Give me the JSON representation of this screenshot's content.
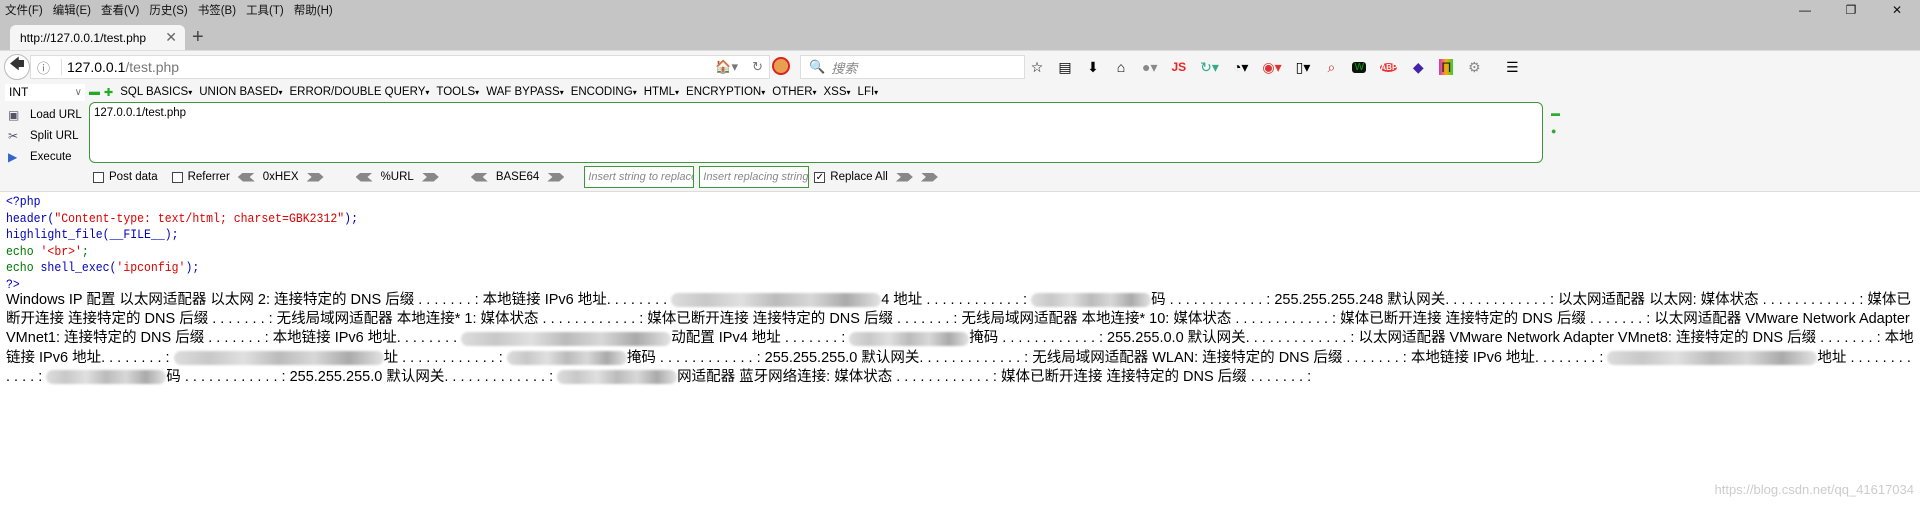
{
  "menubar": {
    "items": [
      "文件(F)",
      "编辑(E)",
      "查看(V)",
      "历史(S)",
      "书签(B)",
      "工具(T)",
      "帮助(H)"
    ]
  },
  "tab": {
    "title": "http://127.0.0.1/test.php"
  },
  "nav": {
    "url_host": "127.0.0.1",
    "url_path": "/test.php",
    "search_placeholder": "搜索"
  },
  "toolbar_icons": [
    "star-icon",
    "reading-list-icon",
    "download-icon",
    "home-icon",
    "globe-icon",
    "js-icon",
    "sync-icon",
    "cookie-icon",
    "hackbar-icon",
    "screenshot-icon",
    "search-highlight-icon",
    "shield-w-icon",
    "adblock-icon",
    "cube-icon",
    "rainbow-icon",
    "gear-icon",
    "hamburger-menu-icon"
  ],
  "hackbar": {
    "select_value": "INT",
    "menus": [
      "SQL BASICS",
      "UNION BASED",
      "ERROR/DOUBLE QUERY",
      "TOOLS",
      "WAF BYPASS",
      "ENCODING",
      "HTML",
      "ENCRYPTION",
      "OTHER",
      "XSS",
      "LFI"
    ],
    "load_url": "Load URL",
    "split_url": "Split URL",
    "execute": "Execute",
    "url_value": "127.0.0.1/test.php",
    "post_data": "Post data",
    "referrer": "Referrer",
    "hex": "0xHEX",
    "url_enc": "%URL",
    "base64": "BASE64",
    "insert_placeholder": "Insert string to replace",
    "replacing_placeholder": "Insert replacing string",
    "replace_all": "Replace All",
    "replace_all_checked": true
  },
  "code": {
    "l1": "<?php",
    "l2a": "header(",
    "l2b": "\"Content-type:  text/html;  charset=GBK2312\"",
    "l2c": ");",
    "l3a": "highlight_file(",
    "l3b": "__FILE__",
    "l3c": ");",
    "l4a": "echo  ",
    "l4b": "'<br>'",
    "l4c": ";",
    "l5a": "echo  ",
    "l5b": "shell_exec(",
    "l5c": "'ipconfig'",
    "l5d": ");",
    "l6": "?>"
  },
  "output": [
    "Windows IP 配置 以太网适配器 以太网 2: 连接特定的 DNS 后缀 . . . . . . . : 本地链接 IPv6 地址. . . . . . . . ",
    "4 地址 . . . . . . . . . . . . : ",
    "码 . . . . . . . . . . . . : 255.255.255.248 默认网关. . . . . . . . . . . . . : 以太网适配器 以太网: 媒体状态 . . . . . . . . . . . . : 媒体已断开连接 连接特定的 DNS 后缀 . . . . . . . : 无线局域网适配器 本地连接* 1: 媒体状态 . . . . . . . . . . . . : 媒体已断开连接 连接特定的 DNS 后缀 . . . . . . . : 无线局域网适配器 本地连接* 10: 媒体状态 . . . . . . . . . . . . : 媒体已断开连接 连接特定的 DNS 后缀 . . . . . . . : 以太网适配器 VMware Network Adapter VMnet1: 连接特定的 DNS 后缀 . . . . . . . : 本地链接 IPv6 地址. . . . . . . . ",
    "动配置 IPv4 地址 . . . . . . . : ",
    "掩码 . . . . . . . . . . . . : 255.255.0.0 默认网关. . . . . . . . . . . . . : 以太网适配器 VMware Network Adapter VMnet8: 连接特定的 DNS 后缀 . . . . . . . : 本地链接 IPv6 地址. . . . . . . . : ",
    "址 . . . . . . . . . . . . : ",
    "掩码 . . . . . . . . . . . . : 255.255.255.0 默认网关. . . . . . . . . . . . . : 无线局域网适配器 WLAN: 连接特定的 DNS 后缀 . . . . . . . : 本地链接 IPv6 地址. . . . . . . . : ",
    "地址 . . . . . . . . . . . . : ",
    "码 . . . . . . . . . . . . : 255.255.255.0 默认网关. . . . . . . . . . . . . : ",
    "网适配器 蓝牙网络连接: 媒体状态 . . . . . . . . . . . . : 媒体已断开连接 连接特定的 DNS 后缀 . . . . . . . :"
  ],
  "watermark": "https://blog.csdn.net/qq_41617034"
}
